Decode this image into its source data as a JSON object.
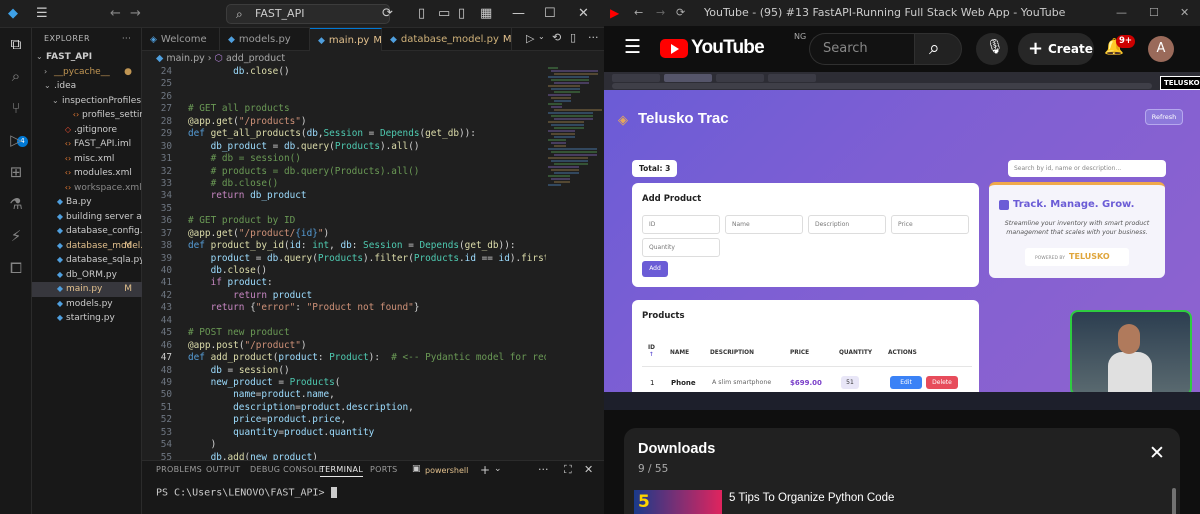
{
  "vscode": {
    "search_text": "FAST_API",
    "explorer_header": "EXPLORER",
    "tree": [
      {
        "label": "FAST_API",
        "indent": 0,
        "kind": "root",
        "chev": "⌄"
      },
      {
        "label": "__pycache__",
        "indent": 1,
        "kind": "folder",
        "chev": "›",
        "dot": "●"
      },
      {
        "label": ".idea",
        "indent": 1,
        "kind": "folder",
        "chev": "⌄"
      },
      {
        "label": "inspectionProfiles",
        "indent": 2,
        "kind": "folder",
        "chev": "⌄"
      },
      {
        "label": "profiles_settings.xml",
        "indent": 3,
        "kind": "xml"
      },
      {
        "label": ".gitignore",
        "indent": 2,
        "kind": "git"
      },
      {
        "label": "FAST_API.iml",
        "indent": 2,
        "kind": "xml"
      },
      {
        "label": "misc.xml",
        "indent": 2,
        "kind": "xml"
      },
      {
        "label": "modules.xml",
        "indent": 2,
        "kind": "xml"
      },
      {
        "label": "workspace.xml",
        "indent": 2,
        "kind": "xml",
        "dim": true
      },
      {
        "label": "Ba.py",
        "indent": 1,
        "kind": "py"
      },
      {
        "label": "building server and g...",
        "indent": 1,
        "kind": "py"
      },
      {
        "label": "database_config.py",
        "indent": 1,
        "kind": "py"
      },
      {
        "label": "database_model...",
        "indent": 1,
        "kind": "py",
        "mod": "M",
        "modcolor": true
      },
      {
        "label": "database_sqla.py",
        "indent": 1,
        "kind": "py"
      },
      {
        "label": "db_ORM.py",
        "indent": 1,
        "kind": "py"
      },
      {
        "label": "main.py",
        "indent": 1,
        "kind": "py",
        "mod": "M",
        "selected": true,
        "modcolor": true
      },
      {
        "label": "models.py",
        "indent": 1,
        "kind": "py"
      },
      {
        "label": "starting.py",
        "indent": 1,
        "kind": "py"
      }
    ],
    "tabs": [
      {
        "label": "Welcome",
        "icon": "vscode"
      },
      {
        "label": "models.py",
        "icon": "py"
      },
      {
        "label": "main.py",
        "icon": "py",
        "mod": "M",
        "active": true
      },
      {
        "label": "database_model.py",
        "icon": "py",
        "mod": "M"
      }
    ],
    "breadcrumb": {
      "file": "main.py",
      "sep": "›",
      "symbol": "add_product"
    },
    "code_lines": [
      {
        "n": "24",
        "html": "        <span class=\"v\">db</span>.<span class=\"f\">close</span>()"
      },
      {
        "n": "25",
        "html": ""
      },
      {
        "n": "26",
        "html": ""
      },
      {
        "n": "27",
        "html": "<span class=\"c\"># GET all products</span>"
      },
      {
        "n": "28",
        "html": "<span class=\"d\">@app</span>.<span class=\"f\">get</span>(<span class=\"s\">\"/products\"</span>)"
      },
      {
        "n": "29",
        "html": "<span class=\"b\">def</span> <span class=\"f\">get_all_products</span>(<span class=\"v\">db</span>,<span class=\"t\">Session</span> = <span class=\"t\">Depends</span>(<span class=\"f\">get_db</span>)):"
      },
      {
        "n": "30",
        "html": "    <span class=\"v\">db_product</span> = <span class=\"v\">db</span>.<span class=\"f\">query</span>(<span class=\"t\">Products</span>).<span class=\"f\">all</span>()"
      },
      {
        "n": "31",
        "html": "    <span class=\"c\"># db = session()</span>"
      },
      {
        "n": "32",
        "html": "    <span class=\"c\"># products = db.query(Products).all()</span>"
      },
      {
        "n": "33",
        "html": "    <span class=\"c\"># db.close()</span>"
      },
      {
        "n": "34",
        "html": "    <span class=\"k\">return</span> <span class=\"v\">db_product</span>"
      },
      {
        "n": "35",
        "html": ""
      },
      {
        "n": "36",
        "html": "<span class=\"c\"># GET product by ID</span>"
      },
      {
        "n": "37",
        "html": "<span class=\"d\">@app</span>.<span class=\"f\">get</span>(<span class=\"s\">\"/product/</span><span class=\"b\">{id}</span><span class=\"s\">\"</span>)"
      },
      {
        "n": "38",
        "html": "<span class=\"b\">def</span> <span class=\"f\">product_by_id</span>(<span class=\"v\">id</span>: <span class=\"t\">int</span>, <span class=\"v\">db</span>: <span class=\"t\">Session</span> = <span class=\"t\">Depends</span>(<span class=\"f\">get_db</span>)):"
      },
      {
        "n": "39",
        "html": "    <span class=\"v\">product</span> = <span class=\"v\">db</span>.<span class=\"f\">query</span>(<span class=\"t\">Products</span>).<span class=\"f\">filter</span>(<span class=\"t\">Products</span>.<span class=\"v\">id</span> == <span class=\"v\">id</span>).<span class=\"f\">first</span>()"
      },
      {
        "n": "40",
        "html": "    <span class=\"v\">db</span>.<span class=\"f\">close</span>()"
      },
      {
        "n": "41",
        "html": "    <span class=\"k\">if</span> <span class=\"v\">product</span>:"
      },
      {
        "n": "42",
        "html": "        <span class=\"k\">return</span> <span class=\"v\">product</span>"
      },
      {
        "n": "43",
        "html": "    <span class=\"k\">return</span> {<span class=\"s\">\"error\"</span>: <span class=\"s\">\"Product not found\"</span>}"
      },
      {
        "n": "44",
        "html": ""
      },
      {
        "n": "45",
        "html": "<span class=\"c\"># POST new product</span>"
      },
      {
        "n": "46",
        "html": "<span class=\"d\">@app</span>.<span class=\"f\">post</span>(<span class=\"s\">\"/product\"</span>)"
      },
      {
        "n": "47",
        "html": "<span class=\"b\">def</span> <span class=\"f\">add_product</span>(<span class=\"v\">product</span>: <span class=\"t\">Product</span>):  <span class=\"c\"># &lt;-- Pydantic model for requests b</span>",
        "cur": true
      },
      {
        "n": "48",
        "html": "    <span class=\"v\">db</span> = <span class=\"f\">session</span>()"
      },
      {
        "n": "49",
        "html": "    <span class=\"v\">new_product</span> = <span class=\"t\">Products</span>("
      },
      {
        "n": "50",
        "html": "        <span class=\"v\">name</span>=<span class=\"v\">product</span>.<span class=\"v\">name</span>,"
      },
      {
        "n": "51",
        "html": "        <span class=\"v\">description</span>=<span class=\"v\">product</span>.<span class=\"v\">description</span>,"
      },
      {
        "n": "52",
        "html": "        <span class=\"v\">price</span>=<span class=\"v\">product</span>.<span class=\"v\">price</span>,"
      },
      {
        "n": "53",
        "html": "        <span class=\"v\">quantity</span>=<span class=\"v\">product</span>.<span class=\"v\">quantity</span>"
      },
      {
        "n": "54",
        "html": "    )"
      },
      {
        "n": "55",
        "html": "    <span class=\"v\">db</span>.<span class=\"f\">add</span>(<span class=\"v\">new_product</span>)"
      }
    ],
    "panel_tabs": [
      "PROBLEMS",
      "OUTPUT",
      "DEBUG CONSOLE",
      "TERMINAL",
      "PORTS"
    ],
    "active_panel_tab": "TERMINAL",
    "terminal_shell": "powershell",
    "terminal_prompt": "PS C:\\Users\\LENOVO\\FAST_API> "
  },
  "youtube": {
    "window_title": "YouTube - (95) #13 FastAPI-Running Full Stack Web App - YouTube",
    "logo_text": "YouTube",
    "country_code": "NG",
    "search_placeholder": "Search",
    "create_label": "Create",
    "notification_count": "9+",
    "avatar_letter": "A",
    "video": {
      "watermark": "TELUSKO",
      "app_title": "Telusko Trac",
      "refresh_label": "Refresh",
      "total_label": "Total: 3",
      "search_placeholder": "Search by id, name or description...",
      "add_product_title": "Add Product",
      "fields": [
        "ID",
        "Name",
        "Description",
        "Price",
        "Quantity"
      ],
      "add_button": "Add",
      "tagline_title": "Track. Manage. Grow.",
      "tagline_text": "Streamline your inventory with smart product management that scales with your business.",
      "powered_label": "POWERED BY",
      "powered_brand": "TELUSKO",
      "products_title": "Products",
      "table_headers": [
        "ID",
        "NAME",
        "DESCRIPTION",
        "PRICE",
        "QUANTITY",
        "ACTIONS"
      ],
      "sort_arrow": "↑",
      "row": {
        "id": "1",
        "name": "Phone",
        "description": "A slim smartphone",
        "price": "$699.00",
        "quantity": "51",
        "edit": "Edit",
        "delete": "Delete"
      }
    },
    "downloads": {
      "title": "Downloads",
      "count": "9 / 55",
      "item_title": "5 Tips To Organize Python Code",
      "thumb_number": "5"
    }
  },
  "colors": {
    "accent": "#0078d4",
    "yt_red": "#ff0000",
    "app_purple": "#6b5cd6",
    "price_purple": "#7a3fc9",
    "delete_red": "#e74c5b",
    "edit_blue": "#3b82f6"
  }
}
